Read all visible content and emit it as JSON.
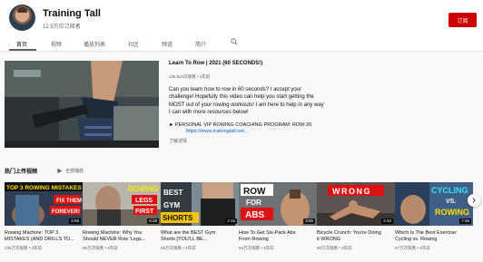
{
  "channel": {
    "name": "Training Tall",
    "subscribers": "12.5万位订阅者",
    "subscribe_label": "订阅"
  },
  "tabs": [
    "首页",
    "视频",
    "播放列表",
    "社区",
    "频道",
    "简介"
  ],
  "featured": {
    "title": "Learn To Row | 2021 (60 SECONDS!)",
    "meta": "135,524次观看 • 3年前",
    "description": [
      "Can you learn how to row in 60 seconds? I accept your",
      "challenge! Hopefully this video can help you start getting the",
      "MOST out of your rowing workouts! I am here to help in any way",
      "I can with more resources below!"
    ],
    "promo": "► PERSONAL VIP ROWING COACHING PROGRAM: ROW-20",
    "link": "https://www.trainingtall.net...",
    "more": "了解详情"
  },
  "uploads": {
    "title": "热门上传视频",
    "play_all": "全部播放"
  },
  "videos": [
    {
      "title_lines": [
        "Rowing Machine: TOP 3",
        "MISTAKES (AND DRILLS TO..."
      ],
      "meta": "135万次观看 • 4年前",
      "duration": "6:59",
      "thumb_text": [
        "TOP 3 ROWING MISTAKES",
        "FIX THEM",
        "FOREVER!"
      ]
    },
    {
      "title_lines": [
        "Rowing Machine: Why You",
        "Should NEVER Row 'Legs..."
      ],
      "meta": "96万次观看 • 4年前",
      "duration": "6:28",
      "thumb_text": [
        "ROWING",
        "LEGS",
        "FIRST"
      ]
    },
    {
      "title_lines": [
        "What are the BEST Gym",
        "Shorts [YOU'LL BE..."
      ],
      "meta": "58万次观看 • 4年前",
      "duration": "2:15",
      "thumb_text": [
        "BEST",
        "GYM",
        "SHORTS"
      ]
    },
    {
      "title_lines": [
        "How To Get Six-Pack Abs",
        "From Rowing"
      ],
      "meta": "54万次观看 • 4年前",
      "duration": "3:55",
      "thumb_text": [
        "ROW",
        "FOR",
        "ABS"
      ]
    },
    {
      "title_lines": [
        "Bicycle Crunch: You're Doing",
        "it WRONG"
      ],
      "meta": "60万次观看 • 3年前",
      "duration": "4:34",
      "thumb_text": [
        "WRONG"
      ]
    },
    {
      "title_lines": [
        "Which Is The Best Exercise:",
        "Cycling vs. Rowing"
      ],
      "meta": "57万次观看 • 4年前",
      "duration": "7:48",
      "thumb_text": [
        "CYCLING",
        "VS.",
        "ROWING"
      ]
    }
  ]
}
